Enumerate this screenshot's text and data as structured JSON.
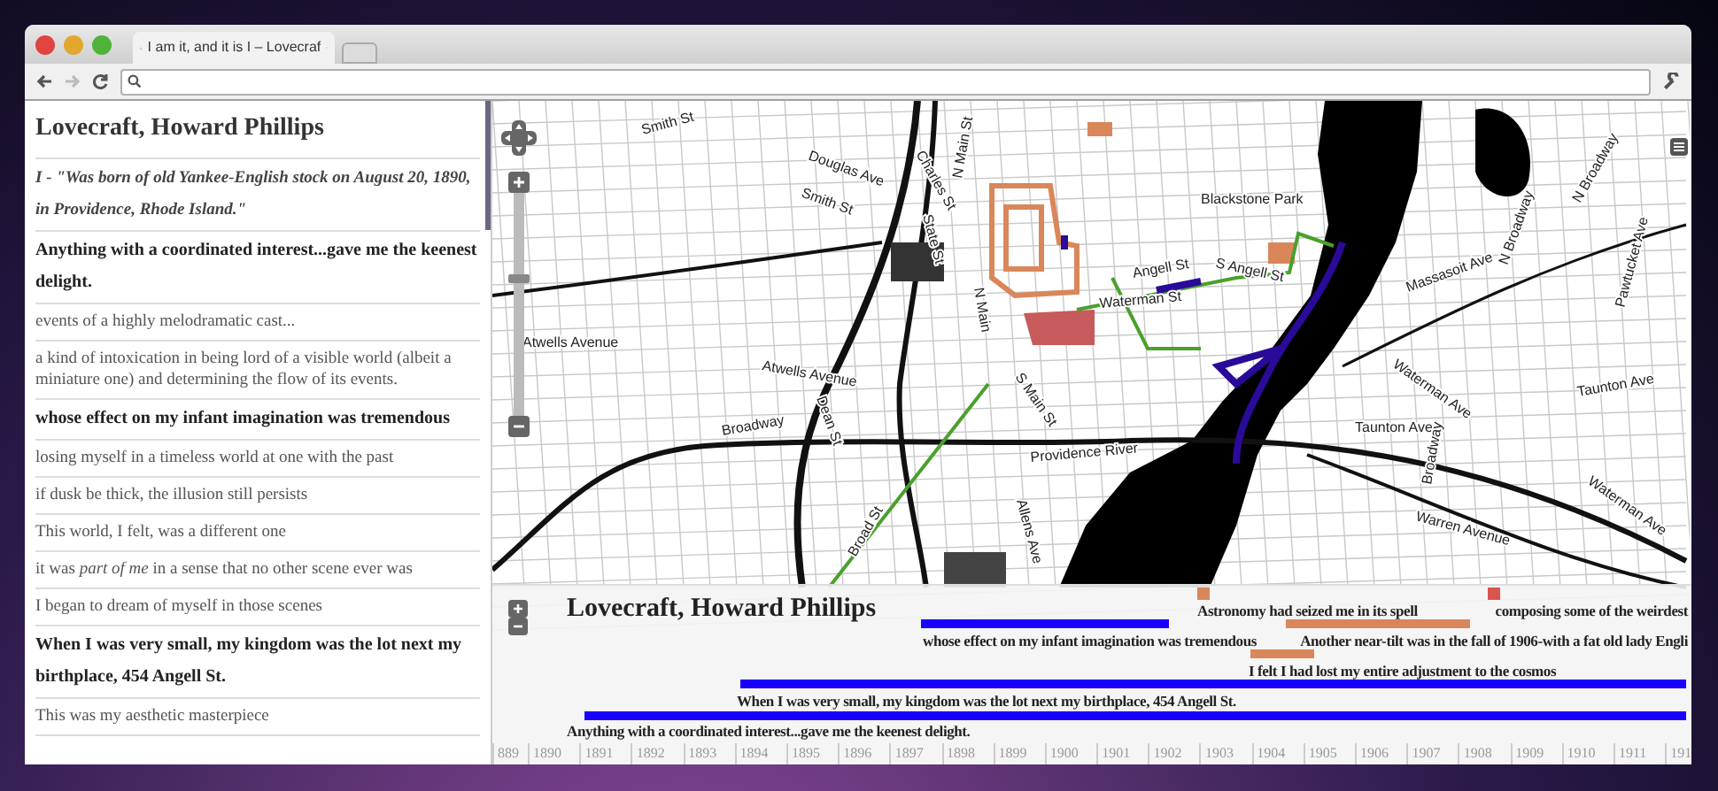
{
  "browser": {
    "tab_title": "I am it, and it is I – Lovecraf"
  },
  "sidebar": {
    "items": [
      {
        "kind": "title",
        "text": "Lovecraft, Howard Phillips"
      },
      {
        "kind": "quote",
        "text": "I - \"Was born of old Yankee-English stock on August 20, 1890, in Providence, Rhode Island.\""
      },
      {
        "kind": "bold",
        "text": "Anything with a coordinated interest...gave me the keenest delight."
      },
      {
        "kind": "plain",
        "text": "events of a highly melodramatic cast..."
      },
      {
        "kind": "plain",
        "text": "a kind of intoxication in being lord of a visible world (albeit a miniature one) and determining the flow of its events."
      },
      {
        "kind": "bold",
        "text": "whose effect on my infant imagination was tremendous"
      },
      {
        "kind": "plain",
        "text": "losing myself in a timeless world at one with the past"
      },
      {
        "kind": "plain",
        "text": "if dusk be thick, the illusion still persists"
      },
      {
        "kind": "plain",
        "text": "This world, I felt, was a different one"
      },
      {
        "kind": "plain",
        "text": "it was *part of me* in a sense that no other scene ever was"
      },
      {
        "kind": "plain",
        "text": "I began to dream of myself in those scenes"
      },
      {
        "kind": "bold",
        "text": "When I was very small, my kingdom was the lot next my birthplace, 454 Angell St."
      },
      {
        "kind": "plain",
        "text": "This was my aesthetic masterpiece"
      }
    ]
  },
  "map": {
    "zoom": {
      "level": 0.62
    },
    "street_labels": [
      "Smith St",
      "Douglas Ave",
      "Smith St",
      "Charles St",
      "N Main St",
      "State St",
      "Atwells Avenue",
      "Atwells Avenue",
      "Broadway",
      "Dean St",
      "Angell St",
      "Waterman St",
      "S Angell St",
      "Blackstone Park",
      "Massasoit Ave",
      "N Broadway",
      "N Broadway",
      "Pawtucket Ave",
      "Waterman Ave",
      "Taunton Ave",
      "Taunton Ave",
      "Providence River",
      "S Main St",
      "Broad St",
      "Warren Avenue",
      "Waterman Ave",
      "Broadway",
      "Allens Ave",
      "N Main"
    ]
  },
  "timeline": {
    "title": "Lovecraft, Howard Phillips",
    "events": [
      {
        "kind": "marker",
        "color": "#d9875a",
        "text": "Astronomy had seized me in its spell"
      },
      {
        "kind": "marker",
        "color": "#d9534f",
        "text": "composing some of the weirdest"
      },
      {
        "kind": "bar",
        "color": "#1a00ff",
        "text": "whose effect on my infant imagination was tremendous"
      },
      {
        "kind": "bar",
        "color": "#d9875a",
        "text": "Another near-tilt was in the fall of 1906-with a fat old lady Engli"
      },
      {
        "kind": "bar",
        "color": "#d9875a",
        "text": "I felt I had lost my entire adjustment to the cosmos"
      },
      {
        "kind": "bar",
        "color": "#1a00ff",
        "text": "When I was very small, my kingdom was the lot next my birthplace, 454 Angell St."
      },
      {
        "kind": "bar",
        "color": "#1a00ff",
        "text": "Anything with a coordinated interest...gave me the keenest delight."
      }
    ],
    "years": [
      "889",
      "1890",
      "1891",
      "1892",
      "1893",
      "1894",
      "1895",
      "1896",
      "1897",
      "1898",
      "1899",
      "1900",
      "1901",
      "1902",
      "1903",
      "1904",
      "1905",
      "1906",
      "1907",
      "1908",
      "1909",
      "1910",
      "1911",
      "191"
    ]
  }
}
